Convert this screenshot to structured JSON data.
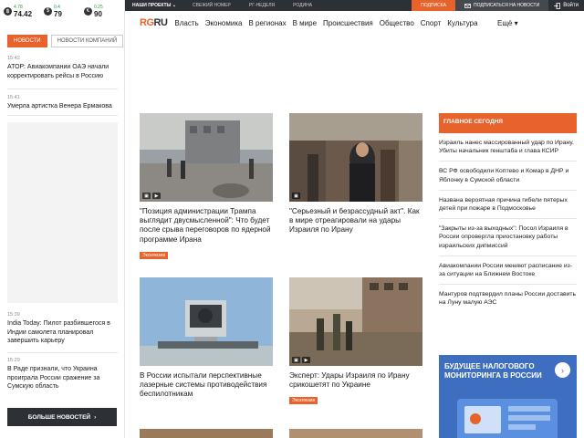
{
  "quotes": [
    {
      "icon": "bitcoin-icon",
      "symbol": "฿",
      "change": "4.78",
      "value": "74.42"
    },
    {
      "icon": "dollar-icon",
      "symbol": "$",
      "change": "0.4",
      "value": "79"
    },
    {
      "icon": "euro-icon",
      "symbol": "€",
      "change": "0.25",
      "value": "90"
    }
  ],
  "sidebar": {
    "tabs": [
      "НОВОСТИ",
      "НОВОСТИ КОМПАНИЙ"
    ],
    "news": [
      {
        "time": "15:42",
        "text": "АТОР: Авиакомпании ОАЭ начали корректировать рейсы в Россию"
      },
      {
        "time": "15:41",
        "text": "Умерла артистка Венера Ермакова"
      },
      {
        "time": "15:39",
        "text": "India Today: Пилот разбившегося в Индии самолета планировал завершить карьеру"
      },
      {
        "time": "15:29",
        "text": "В Раде признали, что Украина проиграла России сражение за Сумскую область"
      }
    ],
    "more_label": "БОЛЬШЕ НОВОСТЕЙ",
    "more_arrow": "›"
  },
  "topbar": {
    "projects": "НАШИ ПРОЕКТЫ",
    "projects_arrow": "⌄",
    "links": [
      "СВЕЖИЙ НОМЕР",
      "РГ-НЕДЕЛЯ",
      "РОДИНА"
    ],
    "subscribe": "ПОДПИСКА",
    "subscribe_news": "ПОДПИСАТЬСЯ НА НОВОСТИ",
    "login": "Войти"
  },
  "nav": {
    "logo_rg": "RG",
    "logo_ru": "RU",
    "items": [
      "Власть",
      "Экономика",
      "В регионах",
      "В мире",
      "Происшествия",
      "Общество",
      "Спорт",
      "Культура"
    ],
    "more": "Ещё",
    "more_arrow": "▾"
  },
  "cards": [
    {
      "title": "\"Позиция администрации Трампа выглядит двусмысленной\": Что будет после срыва переговоров по ядерной программе Ирана",
      "badge": "Эксклюзив",
      "media": true
    },
    {
      "title": "\"Серьезный и безрассудный акт\". Как в мире отреагировали на удары Израиля по Ирану",
      "badge": "",
      "media": true
    },
    {
      "title": "В России испытали перспективные лазерные системы противодействия беспилотникам",
      "badge": "",
      "media": false
    },
    {
      "title": "Эксперт: Удары Израиля по Ирану срикошетят по Украине",
      "badge": "Эксклюзив",
      "media": true
    }
  ],
  "main_today": {
    "heading": "ГЛАВНОЕ СЕГОДНЯ",
    "items": [
      "Израиль нанес массированный удар по Ирану. Убиты начальник генштаба и глава КСИР",
      "ВС РФ освободили Коптево и Комар в ДНР и Яблонку в Сумской области",
      "Названа вероятная причина гибели пятерых детей при пожаре в Подмосковье",
      "\"Закрыты из-за выходных\": Посол Израиля в России опровергла приостановку работы израильских дипмиссий",
      "Авиакомпании России меняют расписание из-за ситуации на Ближнем Востоке",
      "Мантуров подтвердил планы России доставить на Луну малую АЭС"
    ]
  },
  "banner": {
    "text": "БУДУЩЕЕ НАЛОГОВОГО МОНИТОРИНГА В РОССИИ",
    "arrow": "›"
  },
  "colors": {
    "accent": "#e8622c",
    "dark": "#2d3136",
    "banner": "#3d6ec0"
  }
}
